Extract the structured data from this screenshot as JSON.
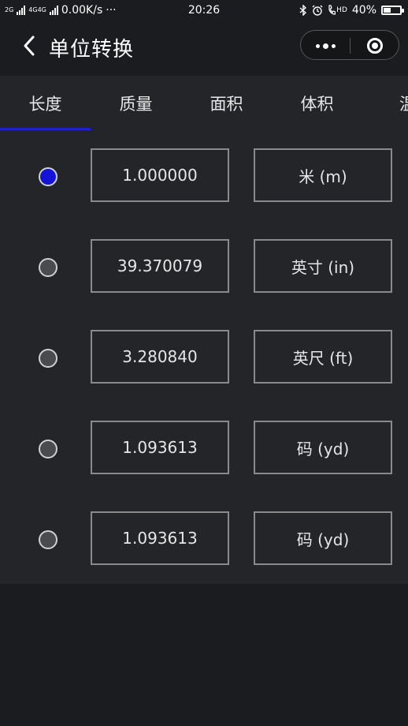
{
  "status_bar": {
    "net_2g": "2G",
    "net_4g": "4G4G",
    "speed": "0.00K/s",
    "more": "···",
    "time": "20:26",
    "hd": "HD",
    "battery_percent": "40%",
    "battery_level": 0.4,
    "icons": [
      "signal-icon",
      "bluetooth-icon",
      "alarm-icon",
      "hd-call-icon",
      "battery-icon"
    ]
  },
  "navbar": {
    "back_icon": "chevron-left-icon",
    "title": "单位转换",
    "capsule_more_icon": "more-dots-icon",
    "capsule_close_icon": "target-icon"
  },
  "tabs": [
    {
      "label": "长度",
      "active": true
    },
    {
      "label": "质量",
      "active": false
    },
    {
      "label": "面积",
      "active": false
    },
    {
      "label": "体积",
      "active": false
    },
    {
      "label": "温",
      "active": false
    }
  ],
  "colors": {
    "accent": "#1a22cc",
    "radio_selected": "#1414d8",
    "panel_bg": "#242529",
    "page_bg": "#1b1c1f",
    "border": "#8a8a8a"
  },
  "rows": [
    {
      "value": "1.000000",
      "unit": "米 (m)",
      "selected": true
    },
    {
      "value": "39.370079",
      "unit": "英寸 (in)",
      "selected": false
    },
    {
      "value": "3.280840",
      "unit": "英尺 (ft)",
      "selected": false
    },
    {
      "value": "1.093613",
      "unit": "码 (yd)",
      "selected": false
    },
    {
      "value": "1.093613",
      "unit": "码 (yd)",
      "selected": false
    }
  ]
}
